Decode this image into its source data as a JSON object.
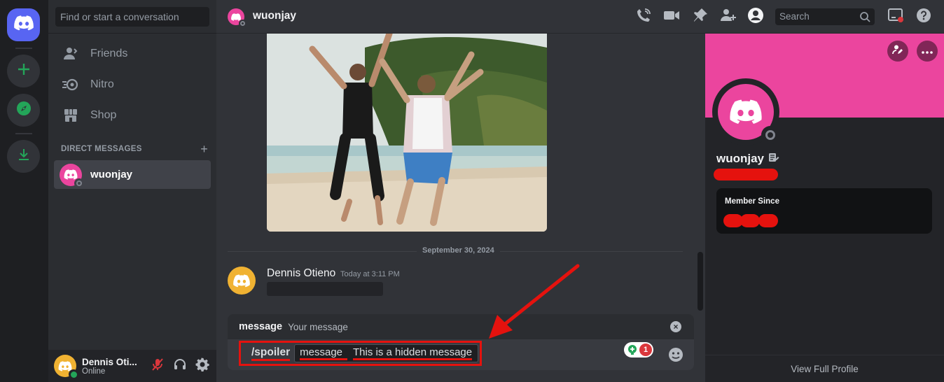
{
  "colors": {
    "accent": "#5865f2",
    "green": "#23a559",
    "banner": "#eb459e",
    "annotation": "#e5120e"
  },
  "sidebar": {
    "search_placeholder": "Find or start a conversation",
    "nav": [
      {
        "label": "Friends",
        "icon": "friends-icon"
      },
      {
        "label": "Nitro",
        "icon": "nitro-icon"
      },
      {
        "label": "Shop",
        "icon": "shop-icon"
      }
    ],
    "dm_header": "DIRECT MESSAGES",
    "dm_add": "+",
    "dms": [
      {
        "name": "wuonjay"
      }
    ],
    "user": {
      "name": "Dennis Oti...",
      "status": "Online"
    }
  },
  "header": {
    "title": "wuonjay",
    "search_placeholder": "Search"
  },
  "chat": {
    "date_divider": "September 30, 2024",
    "message": {
      "author": "Dennis Otieno",
      "time": "Today at 3:11 PM"
    },
    "command": {
      "header_name": "message",
      "header_desc": "Your message",
      "close": "×",
      "name": "/spoiler",
      "option_name": "message",
      "option_value": "This is a hidden message",
      "gift_badge": "1"
    }
  },
  "profile": {
    "name": "wuonjay",
    "member_since_label": "Member Since",
    "footer": "View Full Profile"
  }
}
